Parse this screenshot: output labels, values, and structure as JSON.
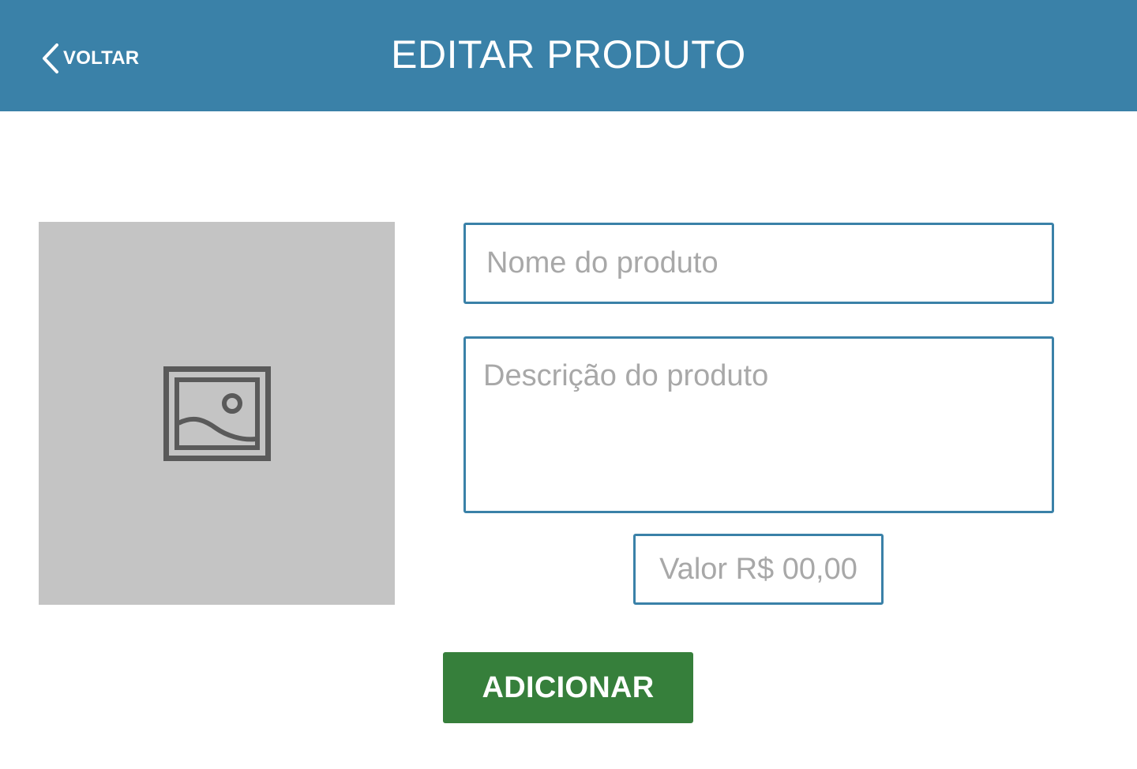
{
  "header": {
    "back_label": "VOLTAR",
    "title": "EDITAR PRODUTO",
    "background_color": "#3a81a8"
  },
  "image_upload": {
    "icon": "image-icon",
    "background_color": "#c4c4c4"
  },
  "form": {
    "name": {
      "value": "",
      "placeholder": "Nome do produto"
    },
    "description": {
      "value": "",
      "placeholder": "Descrição do produto"
    },
    "price": {
      "value": "",
      "placeholder": "Valor R$ 00,00"
    },
    "field_border_color": "#3a81a8"
  },
  "actions": {
    "add_label": "ADICIONAR",
    "add_color": "#367f3b"
  }
}
